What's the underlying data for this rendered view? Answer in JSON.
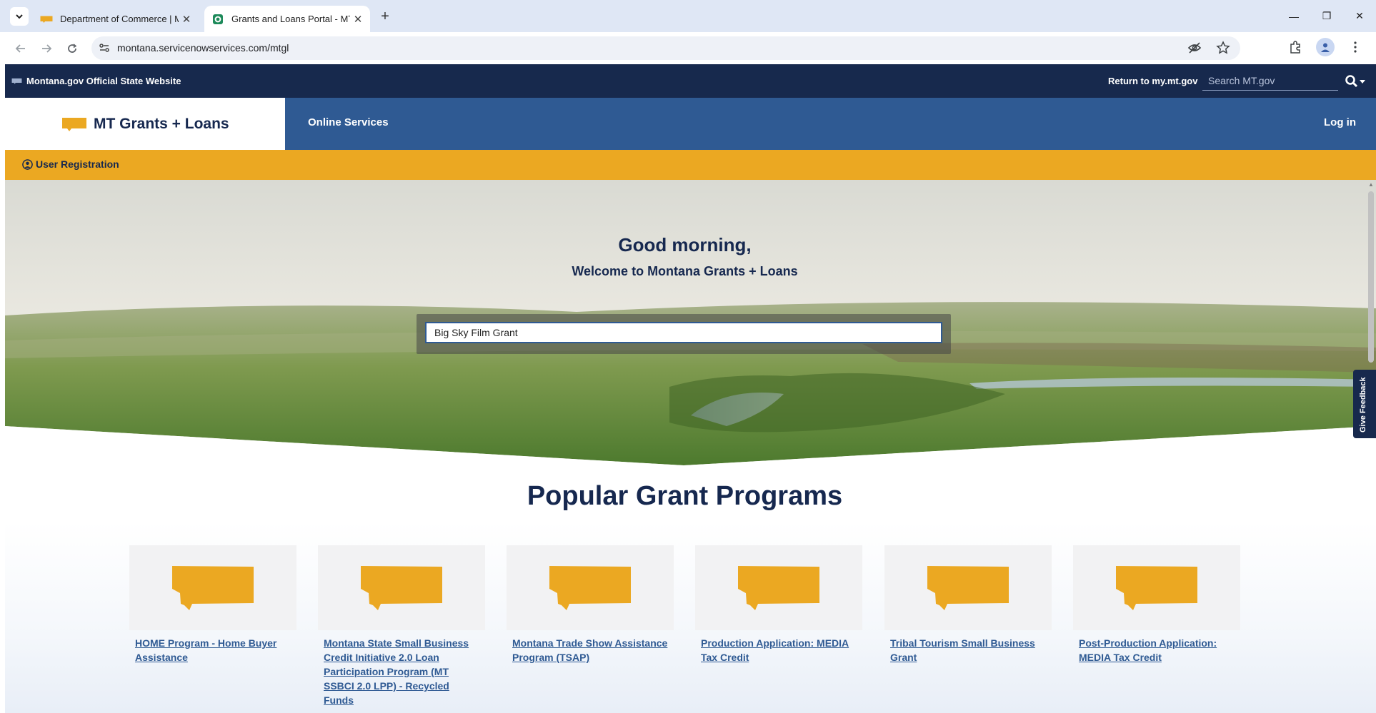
{
  "browser": {
    "tabs": [
      {
        "title": "Department of Commerce | Mo",
        "active": false
      },
      {
        "title": "Grants and Loans Portal - MT G",
        "active": true
      }
    ],
    "url": "montana.servicenowservices.com/mtgl"
  },
  "gov_bar": {
    "label": "Montana.gov Official State Website",
    "return_link": "Return to my.mt.gov",
    "search_placeholder": "Search MT.gov"
  },
  "nav": {
    "brand": "MT Grants + Loans",
    "online_services": "Online Services",
    "login": "Log in"
  },
  "registration": {
    "label": "User Registration"
  },
  "hero": {
    "greeting": "Good morning,",
    "welcome": "Welcome to Montana Grants + Loans",
    "search_value": "Big Sky Film Grant"
  },
  "feedback": {
    "label": "Give Feedback"
  },
  "popular": {
    "title": "Popular Grant Programs",
    "cards": [
      {
        "title": "HOME Program - Home Buyer Assistance"
      },
      {
        "title": "Montana State Small Business Credit Initiative 2.0 Loan Participation Program (MT SSBCI 2.0 LPP) - Recycled Funds"
      },
      {
        "title": "Montana Trade Show Assistance Program (TSAP)"
      },
      {
        "title": "Production Application: MEDIA Tax Credit"
      },
      {
        "title": "Tribal Tourism Small Business Grant"
      },
      {
        "title": "Post-Production Application: MEDIA Tax Credit"
      }
    ]
  },
  "colors": {
    "navy": "#17294d",
    "blue": "#2f5a93",
    "gold": "#eba822"
  },
  "icons": {
    "card_image": "montana-state-icon",
    "brand": "montana-state-icon"
  }
}
